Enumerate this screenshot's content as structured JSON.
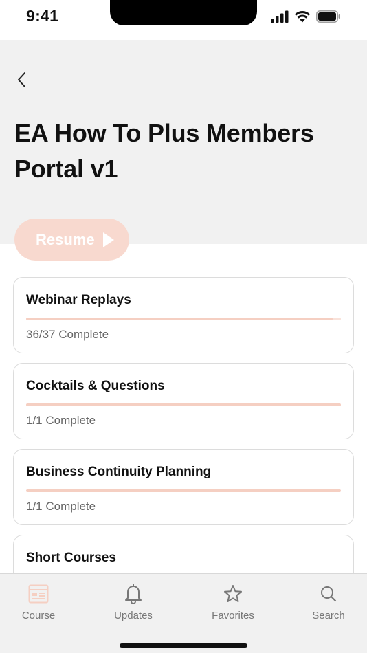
{
  "status_bar": {
    "time": "9:41"
  },
  "header": {
    "title": "EA How To Plus Members Portal v1"
  },
  "resume": {
    "label": "Resume"
  },
  "courses": [
    {
      "title": "Webinar Replays",
      "status": "36/37 Complete",
      "progress": 0.973
    },
    {
      "title": "Cocktails & Questions",
      "status": "1/1 Complete",
      "progress": 1.0
    },
    {
      "title": "Business Continuity Planning",
      "status": "1/1 Complete",
      "progress": 1.0
    },
    {
      "title": "Short Courses",
      "status": "",
      "progress": 0
    }
  ],
  "tabs": [
    {
      "label": "Course",
      "icon": "course-icon",
      "active": true
    },
    {
      "label": "Updates",
      "icon": "bell-icon",
      "active": false
    },
    {
      "label": "Favorites",
      "icon": "star-icon",
      "active": false
    },
    {
      "label": "Search",
      "icon": "search-icon",
      "active": false
    }
  ],
  "colors": {
    "accent": "#f8d9cf",
    "progress_fill": "#f5cfc2",
    "header_bg": "#f1f1f1",
    "text": "#111111",
    "muted": "#666666"
  }
}
